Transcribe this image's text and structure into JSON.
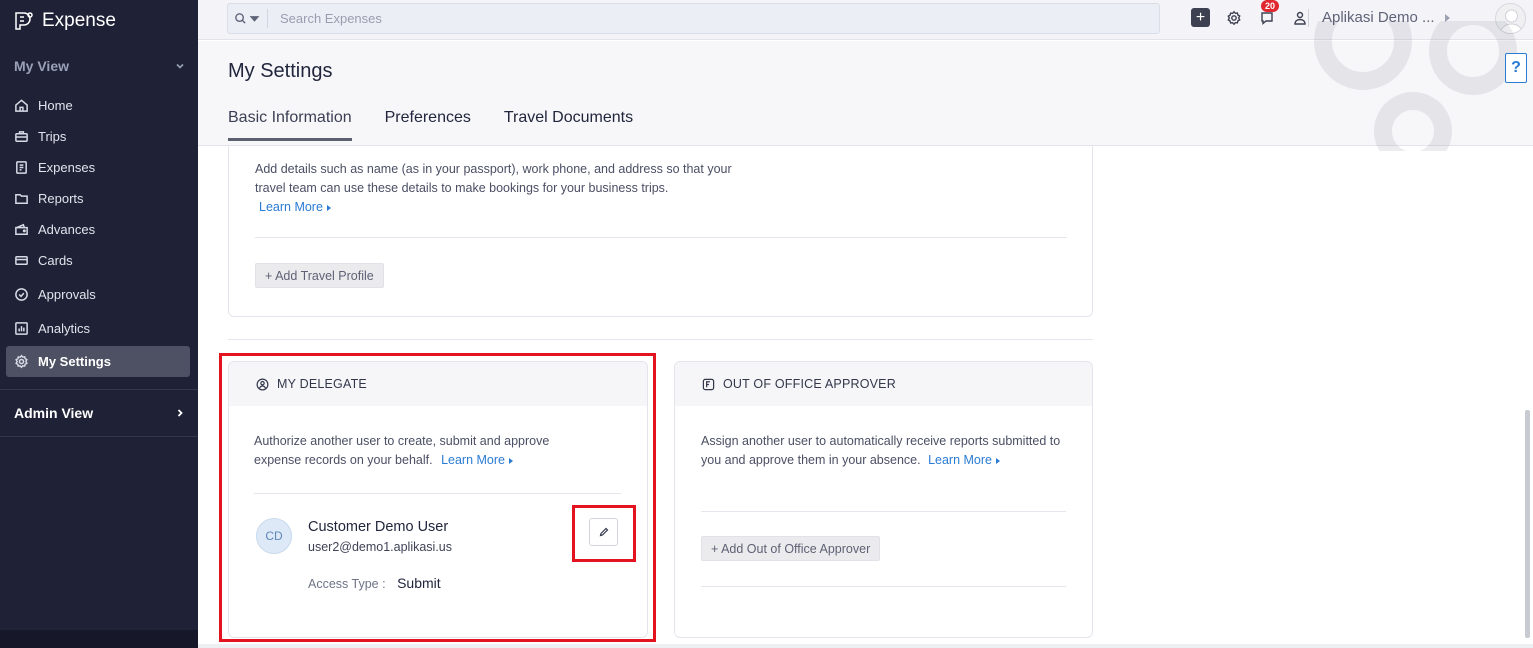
{
  "app": {
    "name": "Expense"
  },
  "sidebar": {
    "my_view_label": "My View",
    "items": [
      {
        "label": "Home",
        "icon": "home-icon"
      },
      {
        "label": "Trips",
        "icon": "briefcase-icon"
      },
      {
        "label": "Expenses",
        "icon": "receipt-icon"
      },
      {
        "label": "Reports",
        "icon": "folder-icon"
      },
      {
        "label": "Advances",
        "icon": "wallet-icon"
      },
      {
        "label": "Cards",
        "icon": "card-icon"
      },
      {
        "label": "Approvals",
        "icon": "check-circle-icon"
      },
      {
        "label": "Analytics",
        "icon": "chart-icon"
      },
      {
        "label": "My Settings",
        "icon": "gear-icon",
        "active": true
      }
    ],
    "admin_view_label": "Admin View"
  },
  "topbar": {
    "search_placeholder": "Search Expenses",
    "notification_count": "20",
    "org_name": "Aplikasi Demo ..."
  },
  "page": {
    "title": "My Settings",
    "tabs": [
      {
        "label": "Basic Information",
        "active": true
      },
      {
        "label": "Preferences"
      },
      {
        "label": "Travel Documents"
      }
    ],
    "help_label": "?"
  },
  "travel_profile": {
    "description": "Add details such as name (as in your passport), work phone, and address so that your travel team can use these details to make bookings for your business trips.",
    "learn_more": "Learn More",
    "add_button": "+ Add Travel Profile"
  },
  "delegate": {
    "heading": "MY DELEGATE",
    "description": "Authorize another user to create, submit and approve expense records on your behalf.",
    "learn_more": "Learn More",
    "user_initials": "CD",
    "user_name": "Customer Demo User",
    "user_email": "user2@demo1.aplikasi.us",
    "access_type_label": "Access Type  :",
    "access_type_value": "Submit"
  },
  "out_of_office": {
    "heading": "OUT OF OFFICE APPROVER",
    "description": "Assign another user to automatically receive reports submitted to you and approve them in your absence.",
    "learn_more": "Learn More",
    "add_button": "+ Add Out of Office Approver"
  },
  "colors": {
    "sidebar_bg": "#1f2236",
    "accent_link": "#2a7bd3",
    "highlight_red": "#e3141f",
    "badge_red": "#e0282f"
  }
}
